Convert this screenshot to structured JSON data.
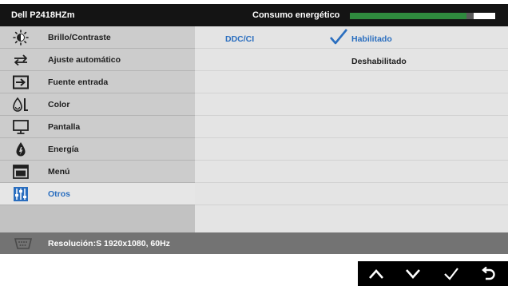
{
  "header": {
    "model": "Dell P2418HZm",
    "energy_label": "Consumo energético",
    "energy_level": 0.8
  },
  "menu": {
    "items": [
      {
        "label": "Brillo/Contraste",
        "icon": "sun-icon"
      },
      {
        "label": "Ajuste automático",
        "icon": "auto-adjust-icon"
      },
      {
        "label": "Fuente entrada",
        "icon": "input-source-icon"
      },
      {
        "label": "Color",
        "icon": "color-icon"
      },
      {
        "label": "Pantalla",
        "icon": "display-icon"
      },
      {
        "label": "Energía",
        "icon": "power-icon"
      },
      {
        "label": "Menú",
        "icon": "menu-icon"
      },
      {
        "label": "Otros",
        "icon": "others-icon"
      }
    ],
    "active_index": 7
  },
  "content": {
    "setting_label": "DDC/CI",
    "options": [
      {
        "label": "Habilitado",
        "selected": true
      },
      {
        "label": "Deshabilitado",
        "selected": false
      }
    ]
  },
  "footer": {
    "resolution": "Resolución:S 1920x1080, 60Hz",
    "icon": "vga-connector-icon"
  },
  "nav": {
    "buttons": [
      {
        "name": "up-button",
        "icon": "chevron-up-icon"
      },
      {
        "name": "down-button",
        "icon": "chevron-down-icon"
      },
      {
        "name": "ok-button",
        "icon": "check-icon"
      },
      {
        "name": "back-button",
        "icon": "back-arrow-icon"
      }
    ]
  },
  "colors": {
    "accent": "#2a6ebf",
    "energy_bar": "#2f8a3e",
    "header_bg": "#141414",
    "footer_bg": "#737373"
  }
}
